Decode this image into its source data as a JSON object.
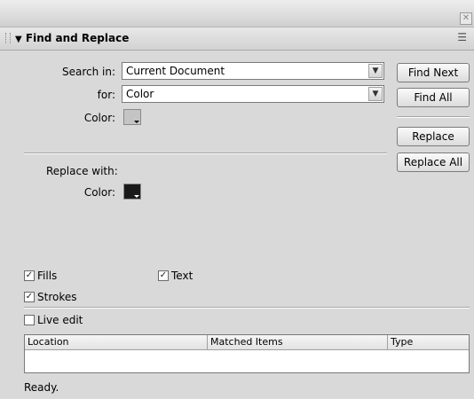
{
  "window": {
    "close_glyph": "✕"
  },
  "panel": {
    "title": "Find and Replace",
    "collapse_glyph": "▼",
    "menu_glyph": "☰"
  },
  "search": {
    "search_in_label": "Search in:",
    "search_in_value": "Current Document",
    "for_label": "for:",
    "for_value": "Color",
    "color_label": "Color:",
    "color_swatch": "#c4c4c4"
  },
  "replace": {
    "label": "Replace with:",
    "color_label": "Color:",
    "color_swatch": "#1a1a1a"
  },
  "buttons": {
    "find_next": "Find Next",
    "find_all": "Find All",
    "replace": "Replace",
    "replace_all": "Replace All"
  },
  "options": {
    "fills": {
      "label": "Fills",
      "checked": true
    },
    "text": {
      "label": "Text",
      "checked": true
    },
    "strokes": {
      "label": "Strokes",
      "checked": true
    },
    "live_edit": {
      "label": "Live edit",
      "checked": false
    }
  },
  "results": {
    "columns": [
      "Location",
      "Matched Items",
      "Type"
    ],
    "rows": []
  },
  "status": "Ready."
}
